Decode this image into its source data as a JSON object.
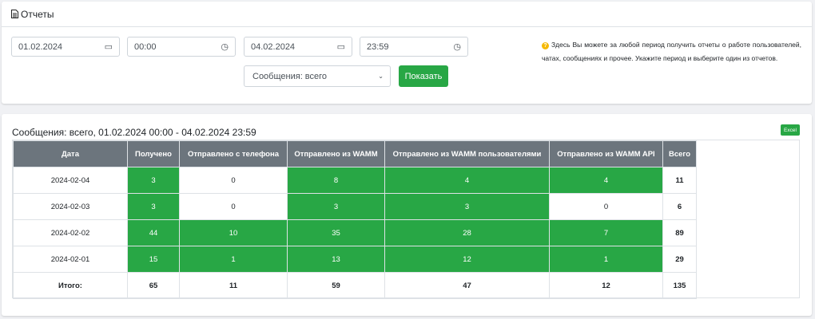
{
  "header": {
    "title": "Отчеты",
    "icon": "file-text-icon"
  },
  "filters": {
    "date_from": "01.02.2024",
    "time_from": "00:00",
    "date_to": "04.02.2024",
    "time_to": "23:59",
    "report_type": "Сообщения: всего",
    "show_label": "Показать"
  },
  "help_text": "Здесь Вы можете за любой период получить отчеты о работе пользователей, чатах, сообщениях и прочее. Укажите период и выберите один из отчетов.",
  "report": {
    "title": "Сообщения: всего, 01.02.2024 00:00 - 04.02.2024 23:59",
    "excel_label": "Excel",
    "columns": [
      "Дата",
      "Получено",
      "Отправлено с телефона",
      "Отправлено из WAMM",
      "Отправлено из WAMM пользователями",
      "Отправлено из WAMM API",
      "Всего"
    ],
    "rows": [
      [
        "2024-02-04",
        "3",
        "0",
        "8",
        "4",
        "4",
        "11"
      ],
      [
        "2024-02-03",
        "3",
        "0",
        "3",
        "3",
        "0",
        "6"
      ],
      [
        "2024-02-02",
        "44",
        "10",
        "35",
        "28",
        "7",
        "89"
      ],
      [
        "2024-02-01",
        "15",
        "1",
        "13",
        "12",
        "1",
        "29"
      ]
    ],
    "totals": [
      "Итого:",
      "65",
      "11",
      "59",
      "47",
      "12",
      "135"
    ]
  },
  "colors": {
    "accent": "#28a745",
    "header_bg": "#6c757d"
  }
}
